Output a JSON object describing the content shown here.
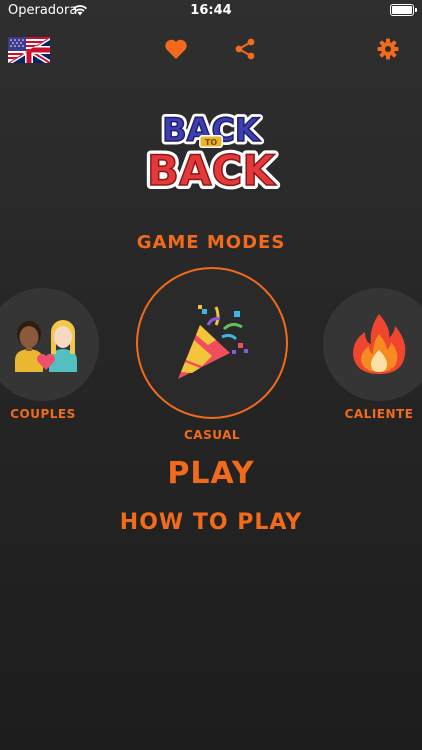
{
  "status_bar": {
    "carrier": "Operadora",
    "time": "16:44",
    "battery_level": 1.0
  },
  "toolbar": {
    "language_icon": "us-uk-flag-icon",
    "favorite_icon": "heart-icon",
    "share_icon": "share-icon",
    "settings_icon": "gear-icon"
  },
  "logo": {
    "line1": "BACK",
    "connector": "TO",
    "line2": "BACK"
  },
  "game_modes": {
    "title": "GAME MODES",
    "modes": [
      {
        "label": "COUPLES",
        "icon": "couple-icon",
        "selected": false
      },
      {
        "label": "CASUAL",
        "icon": "party-popper-icon",
        "selected": true
      },
      {
        "label": "CALIENTE",
        "icon": "fire-icon",
        "selected": false
      }
    ]
  },
  "actions": {
    "play": "PLAY",
    "how_to_play": "HOW TO PLAY"
  },
  "colors": {
    "accent": "#f26a1b",
    "background": "#262626",
    "circle": "#353535"
  }
}
